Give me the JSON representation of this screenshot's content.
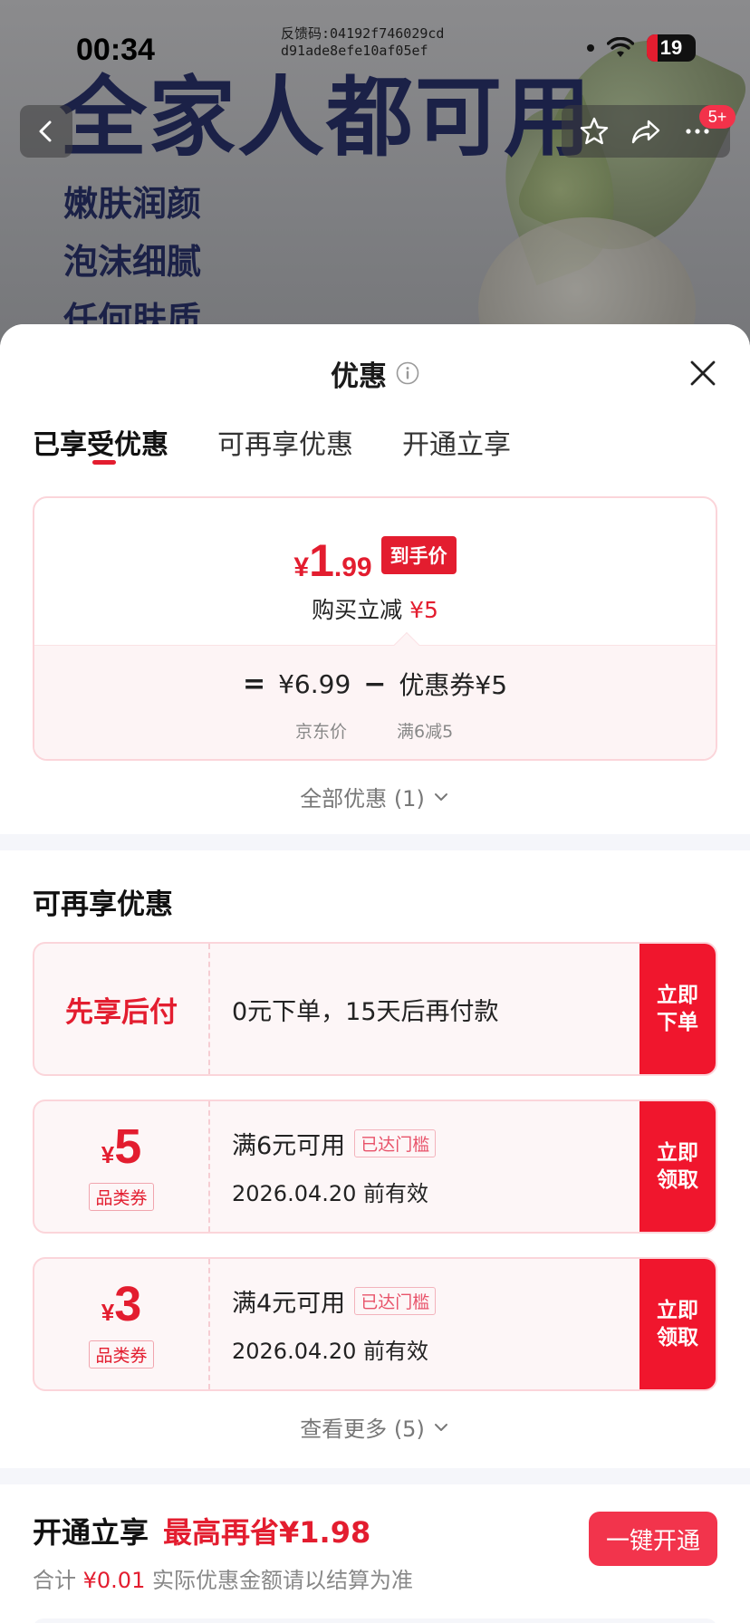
{
  "status_bar": {
    "time": "00:34",
    "battery": "19",
    "feedback_line1": "反馈码:04192f746029cd",
    "feedback_line2": "d91ade8efe10af05ef"
  },
  "product_banner": {
    "headline": "全家人都可用",
    "lines": [
      "嫩肤润颜",
      "泡沫细腻",
      "任何肤质"
    ],
    "message_badge": "5+"
  },
  "sheet": {
    "title": "优惠",
    "tabs": [
      {
        "label": "已享受优惠",
        "active": true
      },
      {
        "label": "可再享优惠",
        "active": false
      },
      {
        "label": "开通立享",
        "active": false
      }
    ],
    "price_card": {
      "yen": "¥",
      "price_int": "1",
      "price_dec": ".99",
      "price_tag": "到手价",
      "instant_text": "购买立减",
      "instant_amount": "¥5",
      "eq": "=",
      "jd_price": "¥6.99",
      "minus": "−",
      "coupon_text": "优惠券¥5",
      "jd_price_label": "京东价",
      "coupon_cond": "满6减5"
    },
    "all_offers": "全部优惠 (1)"
  },
  "more_offers": {
    "title": "可再享优惠",
    "bnpl": {
      "label": "先享后付",
      "text": "0元下单，15天后再付款",
      "action": "立即下单"
    },
    "coupons": [
      {
        "yen": "¥",
        "amount": "5",
        "tag": "品类券",
        "condition": "满6元可用",
        "met": "已达门槛",
        "expire": "2026.04.20 前有效",
        "action": "立即领取"
      },
      {
        "yen": "¥",
        "amount": "3",
        "tag": "品类券",
        "condition": "满4元可用",
        "met": "已达门槛",
        "expire": "2026.04.20 前有效",
        "action": "立即领取"
      }
    ],
    "view_more": "查看更多 (5)"
  },
  "vip": {
    "title": "开通立享",
    "save": "最高再省¥1.98",
    "total_label": "合计",
    "total": "¥0.01",
    "note": "实际优惠金额请以结算为准",
    "button": "一键开通"
  },
  "colors": {
    "accent": "#e31d2f",
    "action_red": "#f0162d",
    "border_pink": "#fbd5da"
  }
}
